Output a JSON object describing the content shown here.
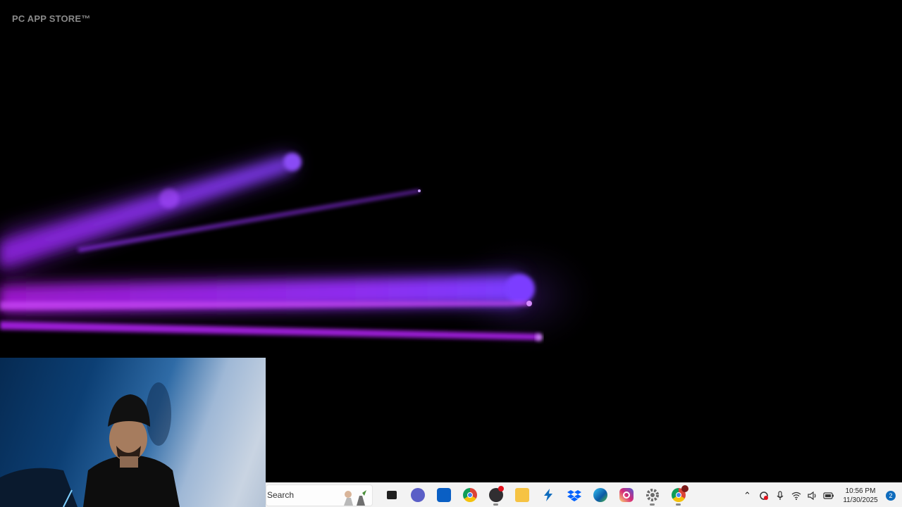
{
  "watermark": "PC APP STORE™",
  "taskbar": {
    "search": {
      "placeholder": "Search",
      "value": ""
    },
    "pinned": [
      {
        "name": "task-view-icon",
        "color": "#1f1f1f"
      },
      {
        "name": "teams-chat-icon",
        "color": "#5b5fc7"
      },
      {
        "name": "microsoft-store-icon",
        "color": "#0a5fc4"
      },
      {
        "name": "chrome-icon",
        "color": "#db4437"
      },
      {
        "name": "obs-studio-icon",
        "color": "#302e31"
      },
      {
        "name": "file-explorer-icon",
        "color": "#f6c343"
      },
      {
        "name": "power-automate-icon",
        "color": "#0f6cbd"
      },
      {
        "name": "dropbox-icon",
        "color": "#0061fe"
      },
      {
        "name": "edge-icon",
        "color": "#0c8adf"
      },
      {
        "name": "instagram-icon",
        "color": "#d62976"
      },
      {
        "name": "settings-icon",
        "color": "#6b6b6b"
      },
      {
        "name": "chrome-profile-icon",
        "color": "#db4437"
      }
    ],
    "clock": {
      "time": "10:56 PM",
      "date": "11/30/2025"
    },
    "notifications": "2"
  },
  "colors": {
    "beam": "#9b30ff",
    "beam_core": "#b04bff",
    "taskbar_bg": "#f3f3f3",
    "accent": "#0f6cbd"
  }
}
